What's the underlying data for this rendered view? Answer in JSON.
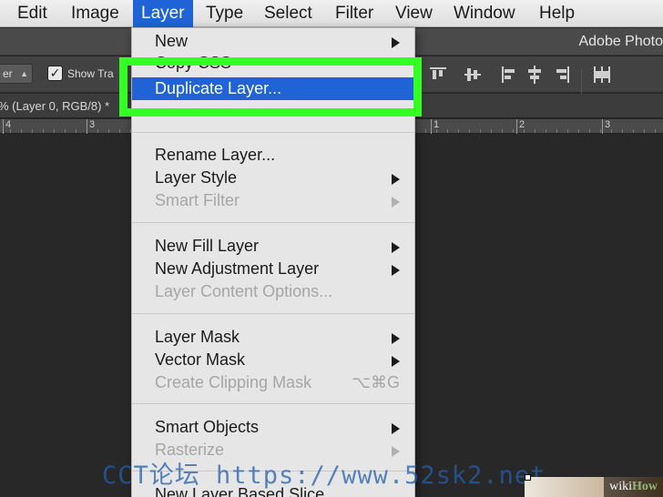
{
  "menubar": {
    "items": [
      "Edit",
      "Image",
      "Layer",
      "Type",
      "Select",
      "Filter",
      "View",
      "Window",
      "Help"
    ],
    "active": "Layer"
  },
  "titlebar": {
    "app_title": "Adobe Photo"
  },
  "options_bar": {
    "select_value": "er",
    "show_transform_label": "Show Tra",
    "show_transform_checked": true
  },
  "document_tab": {
    "title": "% (Layer 0, RGB/8) *"
  },
  "ruler": {
    "numbers": [
      "4",
      "3",
      "1",
      "2",
      "3"
    ]
  },
  "layer_menu": {
    "items": [
      {
        "label": "New",
        "submenu": true,
        "enabled": true
      },
      {
        "label": "Duplicate Layer...",
        "submenu": false,
        "enabled": true,
        "highlighted": true
      },
      {
        "label": "Rename Layer...",
        "submenu": false,
        "enabled": true
      },
      {
        "label": "Layer Style",
        "submenu": true,
        "enabled": true
      },
      {
        "label": "Smart Filter",
        "submenu": true,
        "enabled": false
      },
      {
        "label": "New Fill Layer",
        "submenu": true,
        "enabled": true
      },
      {
        "label": "New Adjustment Layer",
        "submenu": true,
        "enabled": true
      },
      {
        "label": "Layer Content Options...",
        "submenu": false,
        "enabled": false
      },
      {
        "label": "Layer Mask",
        "submenu": true,
        "enabled": true
      },
      {
        "label": "Vector Mask",
        "submenu": true,
        "enabled": true
      },
      {
        "label": "Create Clipping Mask",
        "submenu": false,
        "enabled": false,
        "shortcut": "⌥⌘G"
      },
      {
        "label": "Smart Objects",
        "submenu": true,
        "enabled": true
      },
      {
        "label": "Rasterize",
        "submenu": true,
        "enabled": false
      },
      {
        "label": "New Layer Based Slice",
        "submenu": false,
        "enabled": true
      }
    ]
  },
  "watermark": "CCT论坛 https://www.52sk2.net",
  "branding": {
    "wiki": "wiki",
    "how": "How"
  },
  "colors": {
    "highlight_box": "#33ff22",
    "selection": "#1f63d6",
    "menu_bg": "#e6e6e6",
    "app_bg": "#282828"
  }
}
